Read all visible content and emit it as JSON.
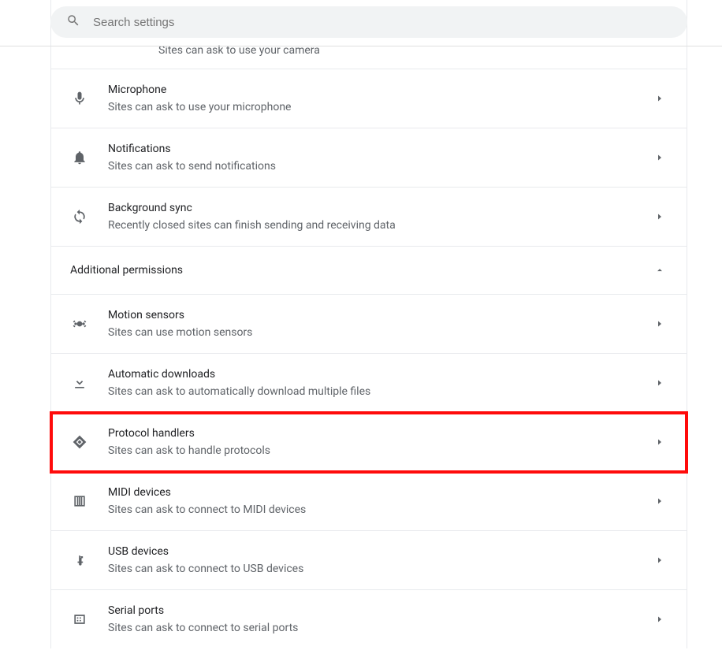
{
  "search": {
    "placeholder": "Search settings"
  },
  "partial": {
    "desc": "Sites can ask to use your camera"
  },
  "rows": {
    "microphone": {
      "title": "Microphone",
      "desc": "Sites can ask to use your microphone"
    },
    "notifications": {
      "title": "Notifications",
      "desc": "Sites can ask to send notifications"
    },
    "background_sync": {
      "title": "Background sync",
      "desc": "Recently closed sites can finish sending and receiving data"
    }
  },
  "section": {
    "title": "Additional permissions"
  },
  "nested": {
    "motion": {
      "title": "Motion sensors",
      "desc": "Sites can use motion sensors"
    },
    "downloads": {
      "title": "Automatic downloads",
      "desc": "Sites can ask to automatically download multiple files"
    },
    "protocol": {
      "title": "Protocol handlers",
      "desc": "Sites can ask to handle protocols"
    },
    "midi": {
      "title": "MIDI devices",
      "desc": "Sites can ask to connect to MIDI devices"
    },
    "usb": {
      "title": "USB devices",
      "desc": "Sites can ask to connect to USB devices"
    },
    "serial": {
      "title": "Serial ports",
      "desc": "Sites can ask to connect to serial ports"
    }
  }
}
